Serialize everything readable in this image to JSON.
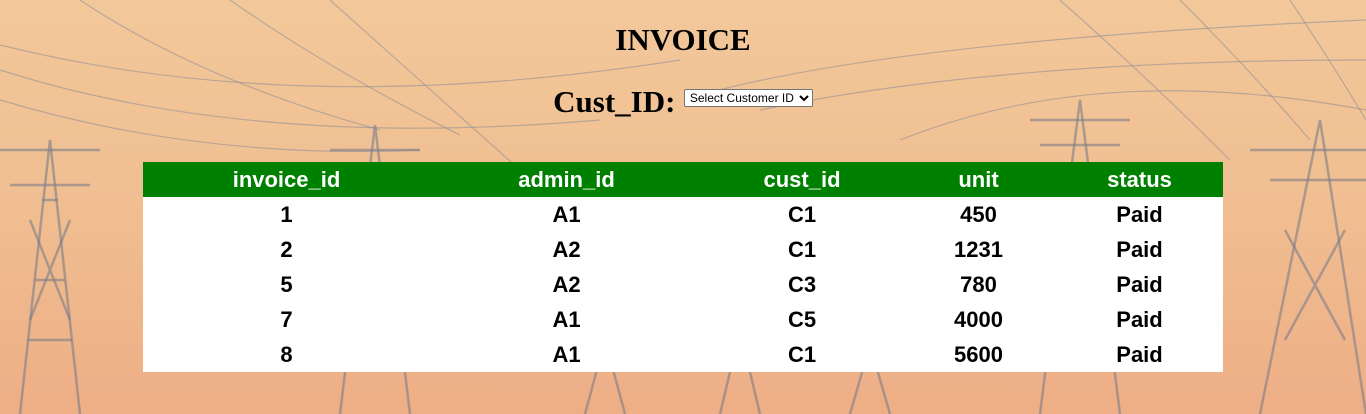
{
  "page": {
    "title": "INVOICE"
  },
  "filter": {
    "label": "Cust_ID:",
    "selected": "Select Customer ID"
  },
  "table": {
    "columns": [
      "invoice_id",
      "admin_id",
      "cust_id",
      "unit",
      "status"
    ],
    "rows": [
      [
        "1",
        "A1",
        "C1",
        "450",
        "Paid"
      ],
      [
        "2",
        "A2",
        "C1",
        "1231",
        "Paid"
      ],
      [
        "5",
        "A2",
        "C3",
        "780",
        "Paid"
      ],
      [
        "7",
        "A1",
        "C5",
        "4000",
        "Paid"
      ],
      [
        "8",
        "A1",
        "C1",
        "5600",
        "Paid"
      ]
    ]
  },
  "colors": {
    "header_background": "#008000",
    "header_text": "#ffffff",
    "table_background": "#ffffff"
  }
}
